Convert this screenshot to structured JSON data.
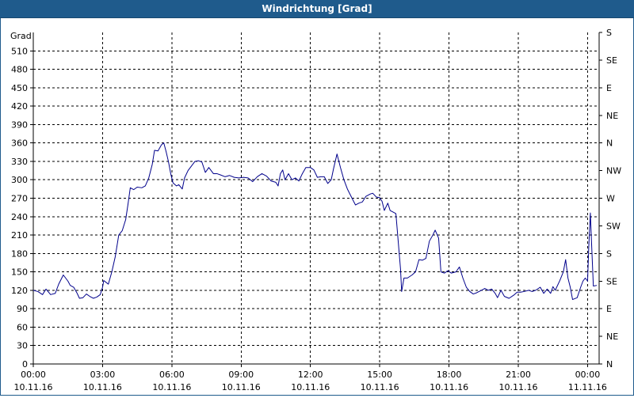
{
  "window": {
    "title": "Windrichtung [Grad]"
  },
  "colors": {
    "titlebar": "#1f5b8c",
    "line": "#00008b",
    "grid": "#000000"
  },
  "chart_data": {
    "type": "line",
    "title": "Windrichtung [Grad]",
    "ylabel": "Grad",
    "ylim": [
      0,
      540
    ],
    "y_ticks": [
      0,
      30,
      60,
      90,
      120,
      150,
      180,
      210,
      240,
      270,
      300,
      330,
      360,
      390,
      420,
      450,
      480,
      510
    ],
    "right_axis": {
      "ticks": [
        0,
        45,
        90,
        135,
        180,
        225,
        270,
        315,
        360,
        405,
        450,
        495,
        540
      ],
      "labels": [
        "N",
        "NE",
        "E",
        "SE",
        "S",
        "SW",
        "W",
        "NW",
        "N",
        "NE",
        "E",
        "SE",
        "S"
      ]
    },
    "x_ticks": [
      {
        "h": 0,
        "time": "00:00",
        "date": "10.11.16"
      },
      {
        "h": 3,
        "time": "03:00",
        "date": "10.11.16"
      },
      {
        "h": 6,
        "time": "06:00",
        "date": "10.11.16"
      },
      {
        "h": 9,
        "time": "09:00",
        "date": "10.11.16"
      },
      {
        "h": 12,
        "time": "12:00",
        "date": "10.11.16"
      },
      {
        "h": 15,
        "time": "15:00",
        "date": "10.11.16"
      },
      {
        "h": 18,
        "time": "18:00",
        "date": "10.11.16"
      },
      {
        "h": 21,
        "time": "21:00",
        "date": "10.11.16"
      },
      {
        "h": 24,
        "time": "00:00",
        "date": "11.11.16"
      }
    ],
    "grid": true,
    "series": [
      {
        "color": "#00008b",
        "points": [
          [
            0.0,
            120
          ],
          [
            0.2,
            118
          ],
          [
            0.4,
            113
          ],
          [
            0.55,
            122
          ],
          [
            0.75,
            113
          ],
          [
            0.95,
            115
          ],
          [
            1.1,
            130
          ],
          [
            1.3,
            145
          ],
          [
            1.5,
            135
          ],
          [
            1.6,
            128
          ],
          [
            1.75,
            125
          ],
          [
            1.9,
            115
          ],
          [
            2.0,
            107
          ],
          [
            2.15,
            108
          ],
          [
            2.3,
            114
          ],
          [
            2.45,
            110
          ],
          [
            2.6,
            107
          ],
          [
            2.75,
            109
          ],
          [
            2.9,
            113
          ],
          [
            3.0,
            125
          ],
          [
            3.05,
            136
          ],
          [
            3.15,
            133
          ],
          [
            3.25,
            130
          ],
          [
            3.4,
            150
          ],
          [
            3.55,
            175
          ],
          [
            3.7,
            210
          ],
          [
            3.85,
            217
          ],
          [
            4.0,
            235
          ],
          [
            4.1,
            260
          ],
          [
            4.2,
            287
          ],
          [
            4.35,
            284
          ],
          [
            4.5,
            288
          ],
          [
            4.7,
            287
          ],
          [
            4.85,
            290
          ],
          [
            5.0,
            303
          ],
          [
            5.15,
            325
          ],
          [
            5.25,
            348
          ],
          [
            5.4,
            347
          ],
          [
            5.55,
            357
          ],
          [
            5.65,
            360
          ],
          [
            5.75,
            346
          ],
          [
            5.85,
            330
          ],
          [
            5.95,
            310
          ],
          [
            6.05,
            295
          ],
          [
            6.2,
            290
          ],
          [
            6.3,
            292
          ],
          [
            6.45,
            285
          ],
          [
            6.55,
            303
          ],
          [
            6.7,
            315
          ],
          [
            6.9,
            325
          ],
          [
            7.0,
            330
          ],
          [
            7.15,
            331
          ],
          [
            7.3,
            329
          ],
          [
            7.45,
            312
          ],
          [
            7.6,
            320
          ],
          [
            7.8,
            310
          ],
          [
            7.95,
            310
          ],
          [
            8.1,
            308
          ],
          [
            8.3,
            305
          ],
          [
            8.5,
            307
          ],
          [
            8.7,
            304
          ],
          [
            8.9,
            303
          ],
          [
            9.1,
            304
          ],
          [
            9.3,
            303
          ],
          [
            9.5,
            297
          ],
          [
            9.7,
            305
          ],
          [
            9.9,
            310
          ],
          [
            10.1,
            306
          ],
          [
            10.3,
            298
          ],
          [
            10.5,
            296
          ],
          [
            10.6,
            290
          ],
          [
            10.7,
            310
          ],
          [
            10.8,
            316
          ],
          [
            10.9,
            300
          ],
          [
            11.05,
            310
          ],
          [
            11.2,
            300
          ],
          [
            11.35,
            303
          ],
          [
            11.5,
            298
          ],
          [
            11.65,
            310
          ],
          [
            11.8,
            320
          ],
          [
            12.0,
            320
          ],
          [
            12.15,
            316
          ],
          [
            12.3,
            304
          ],
          [
            12.45,
            305
          ],
          [
            12.6,
            305
          ],
          [
            12.75,
            294
          ],
          [
            12.9,
            300
          ],
          [
            13.0,
            318
          ],
          [
            13.15,
            342
          ],
          [
            13.3,
            320
          ],
          [
            13.45,
            300
          ],
          [
            13.6,
            285
          ],
          [
            13.8,
            270
          ],
          [
            13.95,
            259
          ],
          [
            14.1,
            262
          ],
          [
            14.25,
            264
          ],
          [
            14.4,
            273
          ],
          [
            14.6,
            277
          ],
          [
            14.7,
            278
          ],
          [
            14.85,
            272
          ],
          [
            15.0,
            271
          ],
          [
            15.1,
            265
          ],
          [
            15.2,
            250
          ],
          [
            15.35,
            262
          ],
          [
            15.45,
            250
          ],
          [
            15.55,
            248
          ],
          [
            15.7,
            245
          ],
          [
            15.8,
            200
          ],
          [
            15.9,
            155
          ],
          [
            15.95,
            118
          ],
          [
            16.05,
            140
          ],
          [
            16.2,
            140
          ],
          [
            16.4,
            145
          ],
          [
            16.55,
            150
          ],
          [
            16.7,
            170
          ],
          [
            16.85,
            169
          ],
          [
            17.0,
            172
          ],
          [
            17.15,
            200
          ],
          [
            17.3,
            210
          ],
          [
            17.4,
            218
          ],
          [
            17.55,
            205
          ],
          [
            17.65,
            150
          ],
          [
            17.8,
            148
          ],
          [
            17.95,
            152
          ],
          [
            18.1,
            148
          ],
          [
            18.3,
            150
          ],
          [
            18.45,
            158
          ],
          [
            18.6,
            140
          ],
          [
            18.75,
            125
          ],
          [
            18.9,
            118
          ],
          [
            19.05,
            114
          ],
          [
            19.2,
            116
          ],
          [
            19.4,
            120
          ],
          [
            19.55,
            123
          ],
          [
            19.7,
            120
          ],
          [
            19.85,
            122
          ],
          [
            20.0,
            115
          ],
          [
            20.1,
            108
          ],
          [
            20.25,
            120
          ],
          [
            20.4,
            110
          ],
          [
            20.6,
            107
          ],
          [
            20.8,
            112
          ],
          [
            20.95,
            117
          ],
          [
            21.1,
            117
          ],
          [
            21.25,
            118
          ],
          [
            21.45,
            120
          ],
          [
            21.6,
            118
          ],
          [
            21.75,
            120
          ],
          [
            21.95,
            125
          ],
          [
            22.1,
            115
          ],
          [
            22.25,
            122
          ],
          [
            22.4,
            115
          ],
          [
            22.5,
            126
          ],
          [
            22.6,
            120
          ],
          [
            22.8,
            136
          ],
          [
            22.95,
            150
          ],
          [
            23.05,
            170
          ],
          [
            23.15,
            140
          ],
          [
            23.25,
            125
          ],
          [
            23.35,
            105
          ],
          [
            23.55,
            108
          ],
          [
            23.7,
            125
          ],
          [
            23.8,
            135
          ],
          [
            23.9,
            140
          ],
          [
            24.0,
            135
          ],
          [
            24.05,
            190
          ],
          [
            24.12,
            246
          ],
          [
            24.18,
            190
          ],
          [
            24.25,
            127
          ],
          [
            24.4,
            128
          ]
        ]
      }
    ]
  }
}
